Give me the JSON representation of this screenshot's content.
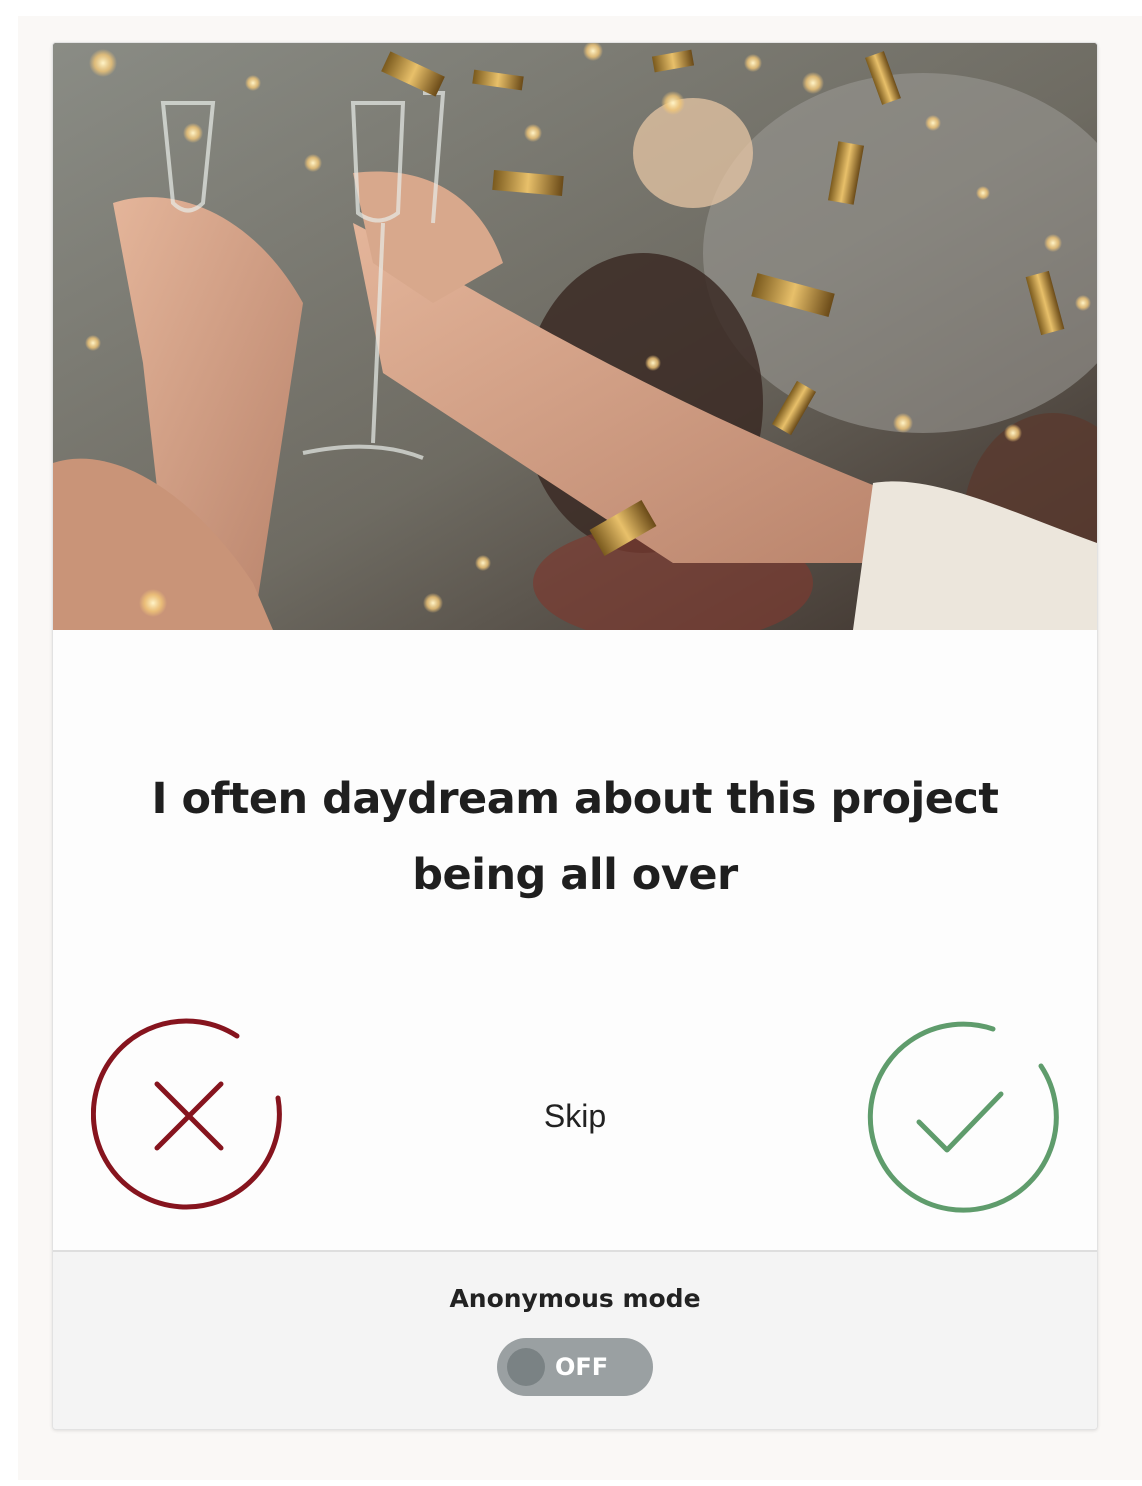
{
  "survey": {
    "question": "I often daydream about this project being all over",
    "skip_label": "Skip",
    "no_icon": "close-icon",
    "yes_icon": "check-icon"
  },
  "anonymous": {
    "label": "Anonymous mode",
    "state_label": "OFF"
  },
  "colors": {
    "no_color": "#86141e",
    "yes_color": "#5f9c6c",
    "toggle_bg": "#9aa0a2"
  }
}
